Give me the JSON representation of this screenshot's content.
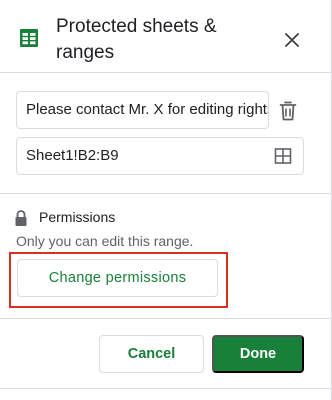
{
  "header": {
    "title": "Protected sheets & ranges"
  },
  "description_input": {
    "value": "Please contact Mr. X for editing rights"
  },
  "range_input": {
    "value": "Sheet1!B2:B9"
  },
  "permissions": {
    "title": "Permissions",
    "subtitle": "Only you can edit this range.",
    "change_button_label": "Change permissions"
  },
  "footer": {
    "cancel_label": "Cancel",
    "done_label": "Done"
  },
  "icons": {
    "sheets": "sheets-icon",
    "close": "close-icon",
    "trash": "trash-icon",
    "grid": "grid-icon",
    "lock": "lock-icon"
  },
  "colors": {
    "accent": "#188038",
    "highlight": "#d93025",
    "border": "#dadce0",
    "muted_text": "#5f6368"
  }
}
